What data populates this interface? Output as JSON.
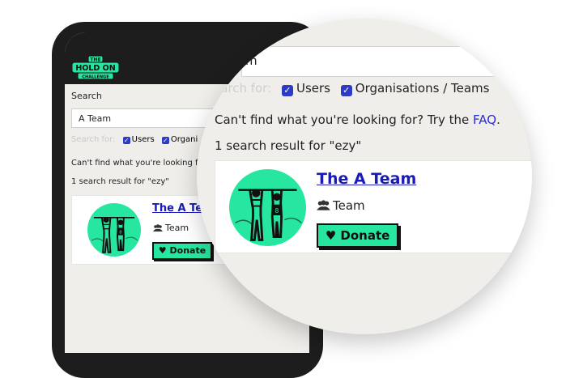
{
  "app": {
    "logo_top": "THE",
    "logo_main": "HOLD ON",
    "logo_bottom": "CHALLENGE"
  },
  "search": {
    "label": "Search",
    "value": "A Team",
    "magnified_value": "m",
    "filters_label": "Search for:",
    "filters_label_magnified": "earch for:",
    "users_label": "Users",
    "orgs_label": "Organisations / Teams",
    "orgs_label_truncated": "Organi",
    "help_text": "Can't find what you're looking for? Try the",
    "help_text_truncated": "Can't find what you're looking fo",
    "faq_link": "FAQ",
    "result_count": "1 search result for \"ezy\""
  },
  "result": {
    "name": "The A Team",
    "name_truncated": "The A Tean",
    "type": "Team",
    "donate_label": "Donate"
  },
  "icons": {
    "checkbox": "checkbox-checked-icon",
    "team": "users-icon",
    "donate": "heart-icon"
  },
  "colors": {
    "accent_green": "#27e6a0",
    "link_blue": "#1a1ab8",
    "checkbox_blue": "#2f3ac4",
    "page_bg": "#efeeea"
  }
}
